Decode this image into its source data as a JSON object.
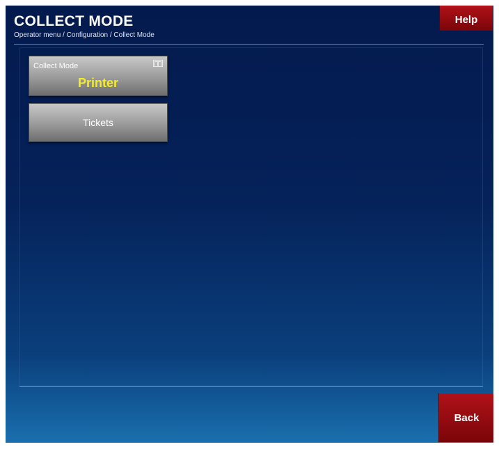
{
  "header": {
    "title": "COLLECT MODE",
    "breadcrumb": "Operator menu / Configuration / Collect Mode",
    "help_label": "Help"
  },
  "tiles": [
    {
      "label": "Collect Mode",
      "value": "Printer",
      "icon": "toggle-icon"
    },
    {
      "label": "Tickets"
    }
  ],
  "footer": {
    "back_label": "Back"
  },
  "colors": {
    "background_top": "#031a4d",
    "background_bottom": "#1a6fae",
    "button_red": "#9a0c11",
    "tile_gray": "#9a9a9a",
    "value_yellow": "#f3ec2a"
  }
}
